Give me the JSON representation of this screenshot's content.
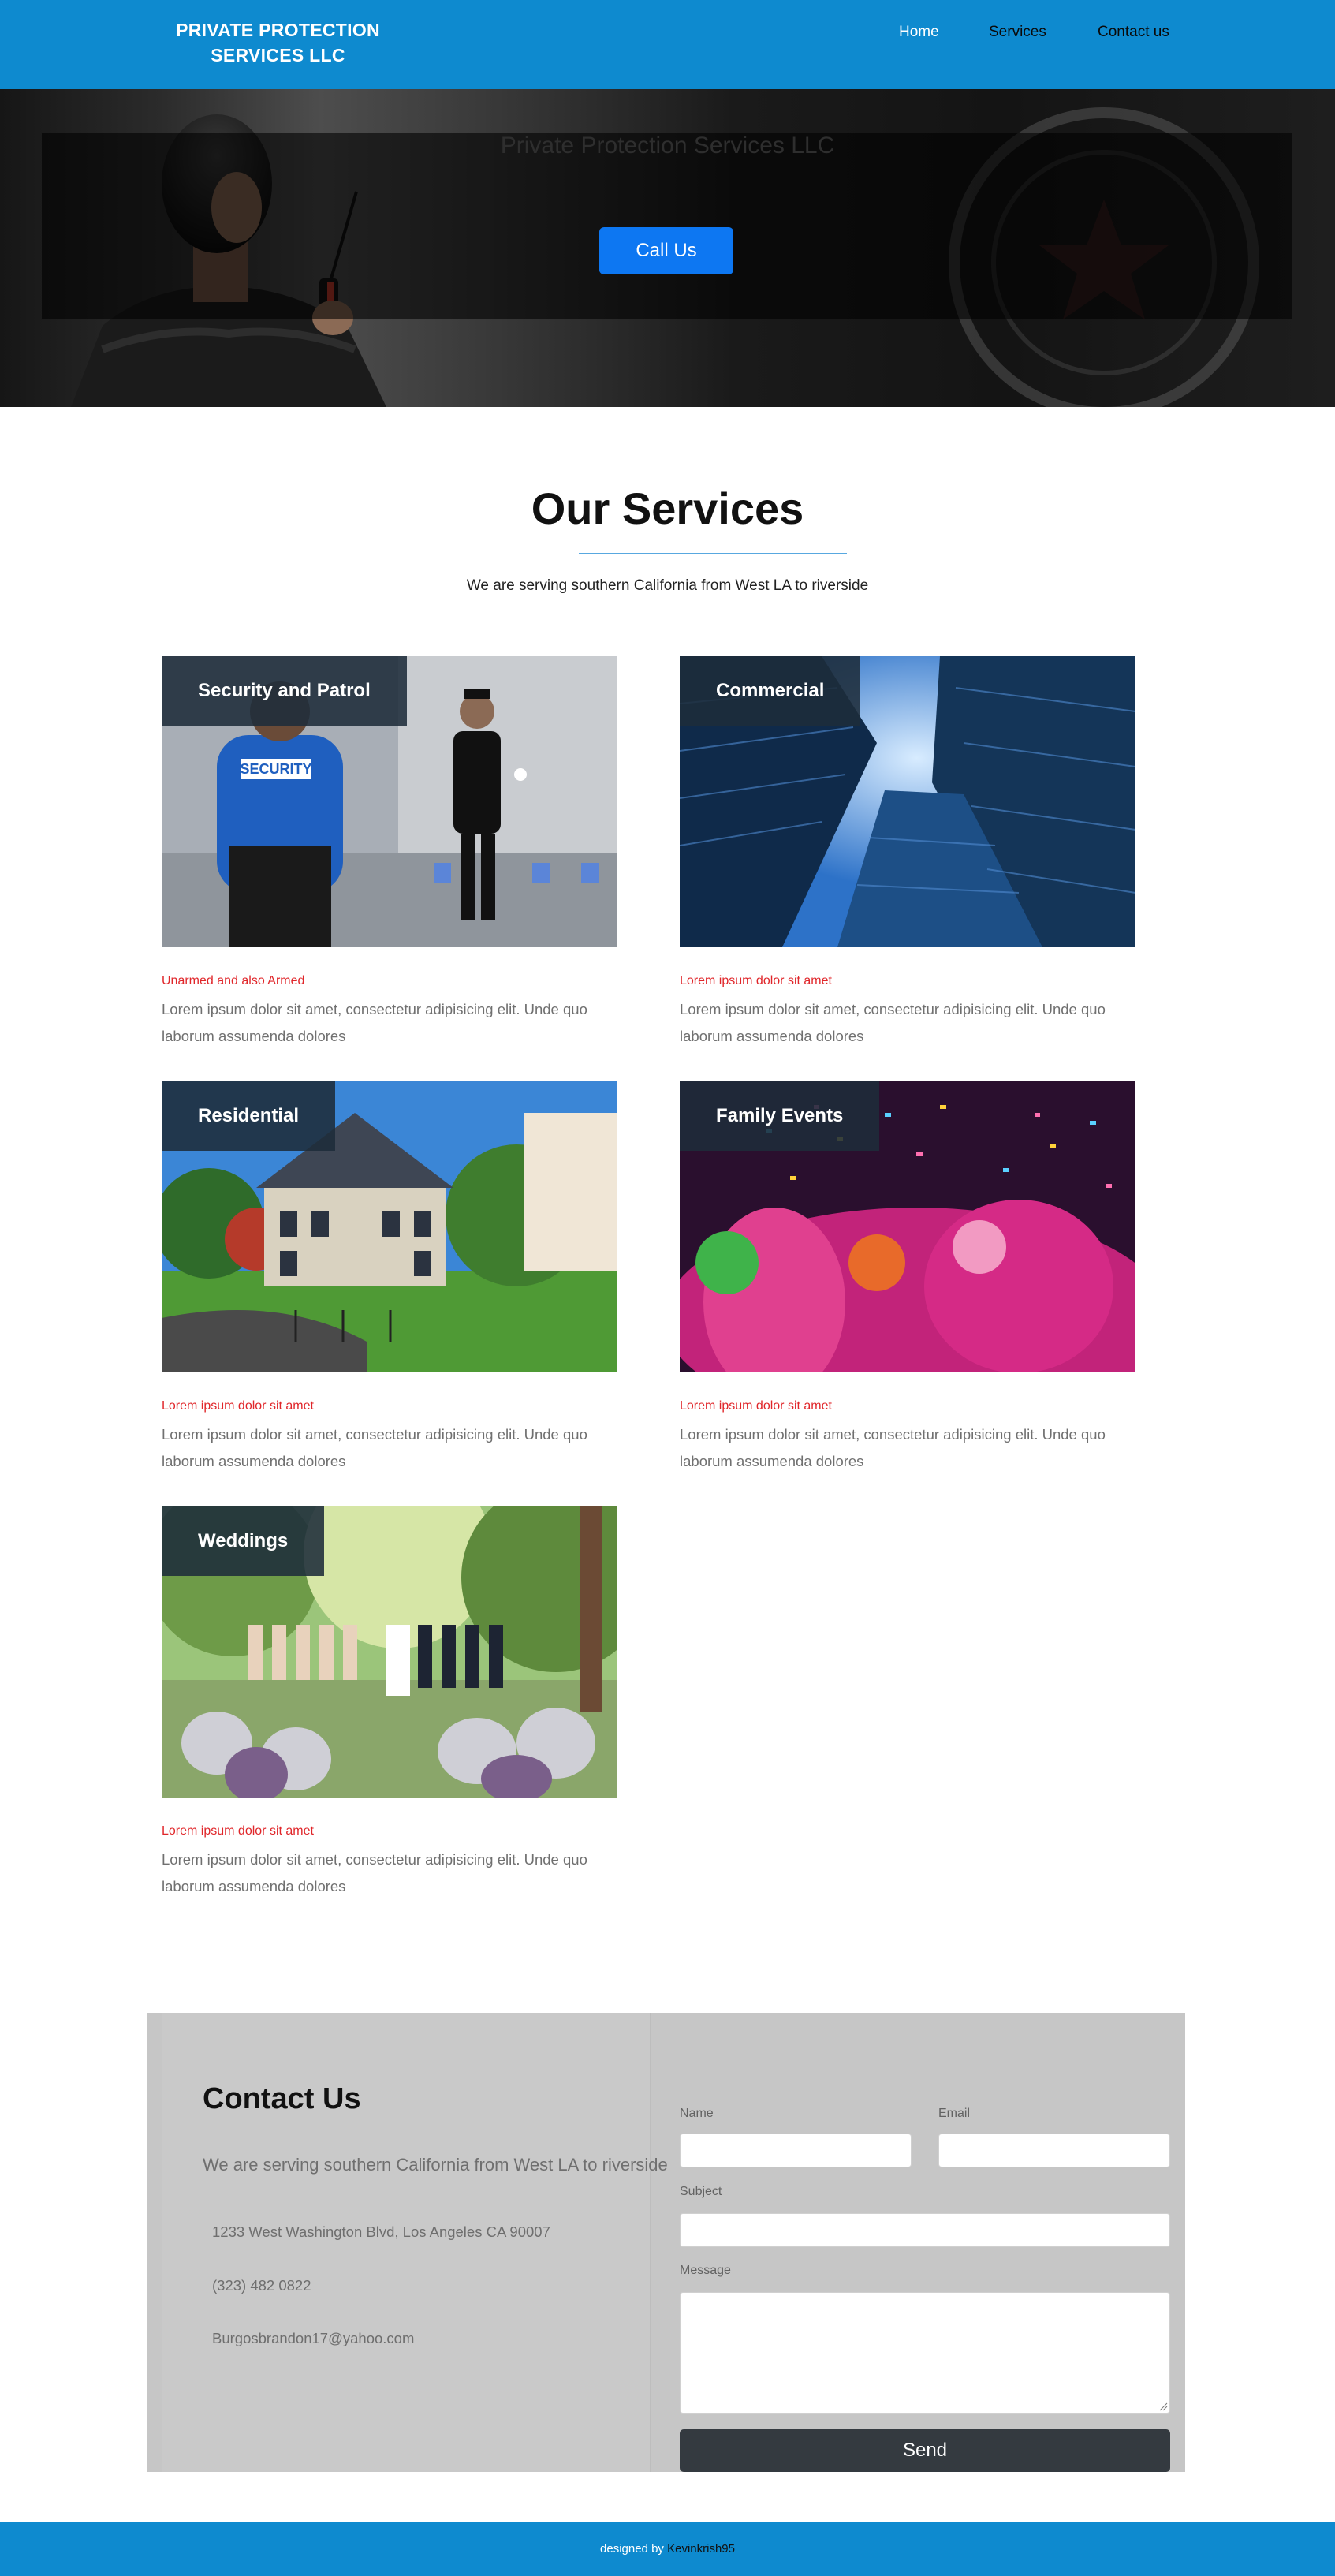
{
  "navbar": {
    "brand": "PRIVATE PROTECTION SERVICES LLC",
    "links": [
      {
        "label": "Home",
        "active": true
      },
      {
        "label": "Services",
        "active": false
      },
      {
        "label": "Contact us",
        "active": false
      }
    ]
  },
  "hero": {
    "title": "Private Protection Services LLC",
    "cta_label": "Call Us"
  },
  "services": {
    "heading": "Our Services",
    "subheading": "We are serving southern California from West LA to riverside",
    "cards": [
      {
        "title": "Security and Patrol",
        "kicker": "Unarmed and also Armed",
        "text": "Lorem ipsum dolor sit amet, consectetur adipisicing elit. Unde quo laborum assumenda dolores"
      },
      {
        "title": "Commercial",
        "kicker": "Lorem ipsum dolor sit amet",
        "text": "Lorem ipsum dolor sit amet, consectetur adipisicing elit. Unde quo laborum assumenda dolores"
      },
      {
        "title": "Residential",
        "kicker": "Lorem ipsum dolor sit amet",
        "text": "Lorem ipsum dolor sit amet, consectetur adipisicing elit. Unde quo laborum assumenda dolores"
      },
      {
        "title": "Family Events",
        "kicker": "Lorem ipsum dolor sit amet",
        "text": "Lorem ipsum dolor sit amet, consectetur adipisicing elit. Unde quo laborum assumenda dolores"
      },
      {
        "title": "Weddings",
        "kicker": "Lorem ipsum dolor sit amet",
        "text": "Lorem ipsum dolor sit amet, consectetur adipisicing elit. Unde quo laborum assumenda dolores"
      }
    ]
  },
  "contact": {
    "title": "Contact Us",
    "subtitle": "We are serving southern California from West LA to riverside",
    "address": "1233 West Washington Blvd, Los Angeles CA 90007",
    "phone": "(323) 482 0822",
    "email": "Burgosbrandon17@yahoo.com",
    "form": {
      "name_label": "Name",
      "email_label": "Email",
      "subject_label": "Subject",
      "message_label": "Message",
      "send_label": "Send"
    }
  },
  "footer": {
    "prefix": "designed by",
    "author": "Kevinkrish95"
  },
  "colors": {
    "brand_blue": "#0e8acf",
    "cta_blue": "#0d77f2",
    "kicker_red": "#e0262a",
    "send_dark": "#343a40"
  }
}
